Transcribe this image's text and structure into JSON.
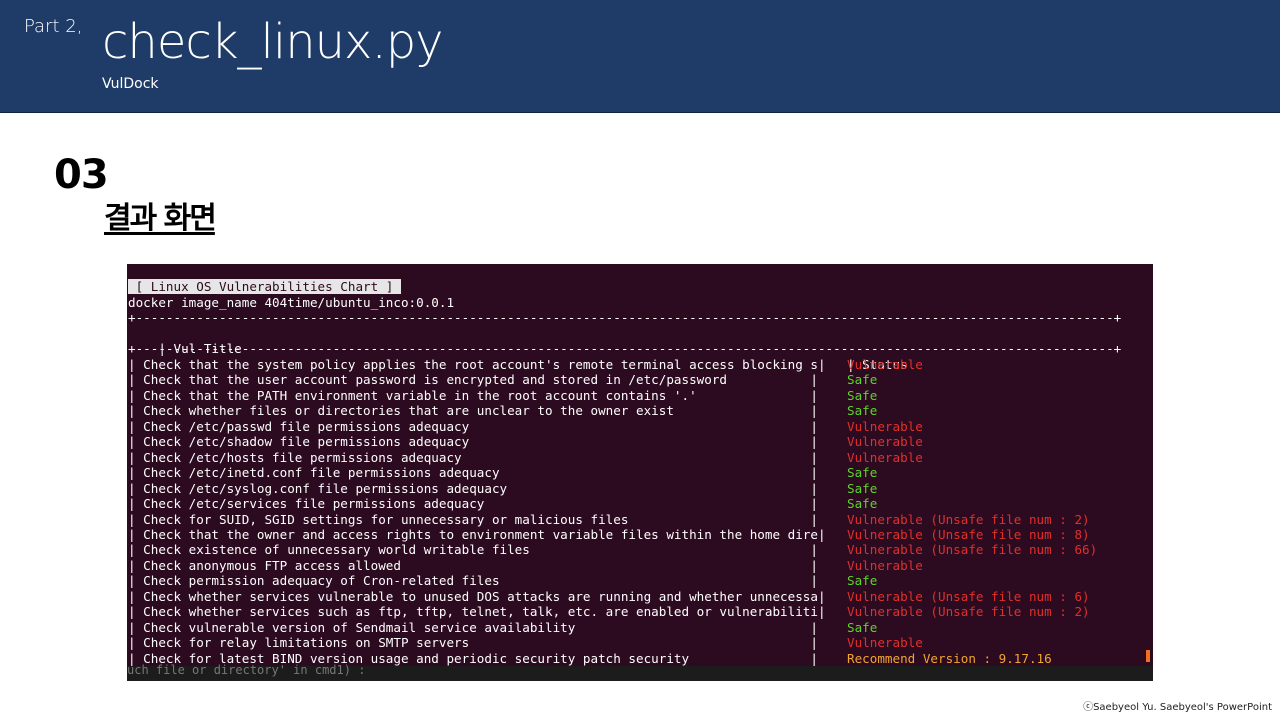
{
  "header": {
    "part": "Part 2,",
    "title": "check_linux.py",
    "subtitle": "VulDock"
  },
  "section": {
    "number": "03",
    "title": "결과 화면"
  },
  "terminal": {
    "chart_title": " [ Linux OS Vulnerabilities Chart ] ",
    "image_line": "docker image_name 404time/ubuntu_inco:0.0.1",
    "separator": "+---------------------------------------------------------------------------------------------------------------------------------+",
    "header_title": "| Vul Title",
    "header_status": "| Status",
    "rows": [
      {
        "title": "| Check that the system policy applies the root account's remote terminal access blocking s|",
        "status": "Vulnerable",
        "color": "#e0302c"
      },
      {
        "title": "| Check that the user account password is encrypted and stored in /etc/password           |",
        "status": "Safe",
        "color": "#5ed42c"
      },
      {
        "title": "| Check that the PATH environment variable in the root account contains '.'               |",
        "status": "Safe",
        "color": "#5ed42c"
      },
      {
        "title": "| Check whether files or directories that are unclear to the owner exist                  |",
        "status": "Safe",
        "color": "#5ed42c"
      },
      {
        "title": "| Check /etc/passwd file permissions adequacy                                             |",
        "status": "Vulnerable",
        "color": "#e0302c"
      },
      {
        "title": "| Check /etc/shadow file permissions adequacy                                             |",
        "status": "Vulnerable",
        "color": "#e0302c"
      },
      {
        "title": "| Check /etc/hosts file permissions adequacy                                              |",
        "status": "Vulnerable",
        "color": "#e0302c"
      },
      {
        "title": "| Check /etc/inetd.conf file permissions adequacy                                         |",
        "status": "Safe",
        "color": "#5ed42c"
      },
      {
        "title": "| Check /etc/syslog.conf file permissions adequacy                                        |",
        "status": "Safe",
        "color": "#5ed42c"
      },
      {
        "title": "| Check /etc/services file permissions adequacy                                           |",
        "status": "Safe",
        "color": "#5ed42c"
      },
      {
        "title": "| Check for SUID, SGID settings for unnecessary or malicious files                        |",
        "status": "Vulnerable (Unsafe file num : 2)",
        "color": "#e0302c"
      },
      {
        "title": "| Check that the owner and access rights to environment variable files within the home dire|",
        "status": "Vulnerable (Unsafe file num : 8)",
        "color": "#e0302c"
      },
      {
        "title": "| Check existence of unnecessary world writable files                                     |",
        "status": "Vulnerable (Unsafe file num : 66)",
        "color": "#e0302c"
      },
      {
        "title": "| Check anonymous FTP access allowed                                                      |",
        "status": "Vulnerable",
        "color": "#e0302c"
      },
      {
        "title": "| Check permission adequacy of Cron-related files                                         |",
        "status": "Safe",
        "color": "#5ed42c"
      },
      {
        "title": "| Check whether services vulnerable to unused DOS attacks are running and whether unnecessa|",
        "status": "Vulnerable (Unsafe file num : 6)",
        "color": "#e0302c"
      },
      {
        "title": "| Check whether services such as ftp, tftp, telnet, talk, etc. are enabled or vulnerabiliti|",
        "status": "Vulnerable (Unsafe file num : 2)",
        "color": "#e0302c"
      },
      {
        "title": "| Check vulnerable version of Sendmail service availability                               |",
        "status": "Safe",
        "color": "#5ed42c"
      },
      {
        "title": "| Check for relay limitations on SMTP servers                                             |",
        "status": "Vulnerable",
        "color": "#e0302c"
      },
      {
        "title": "| Check for latest BIND version usage and periodic security patch security                |",
        "status": "Recommend Version : 9.17.16",
        "color": "#f0a630"
      }
    ],
    "footer_text": "uch file or directory' in cmd1) :"
  },
  "copyright": "ⓒSaebyeol Yu. Saebyeol's PowerPoint"
}
